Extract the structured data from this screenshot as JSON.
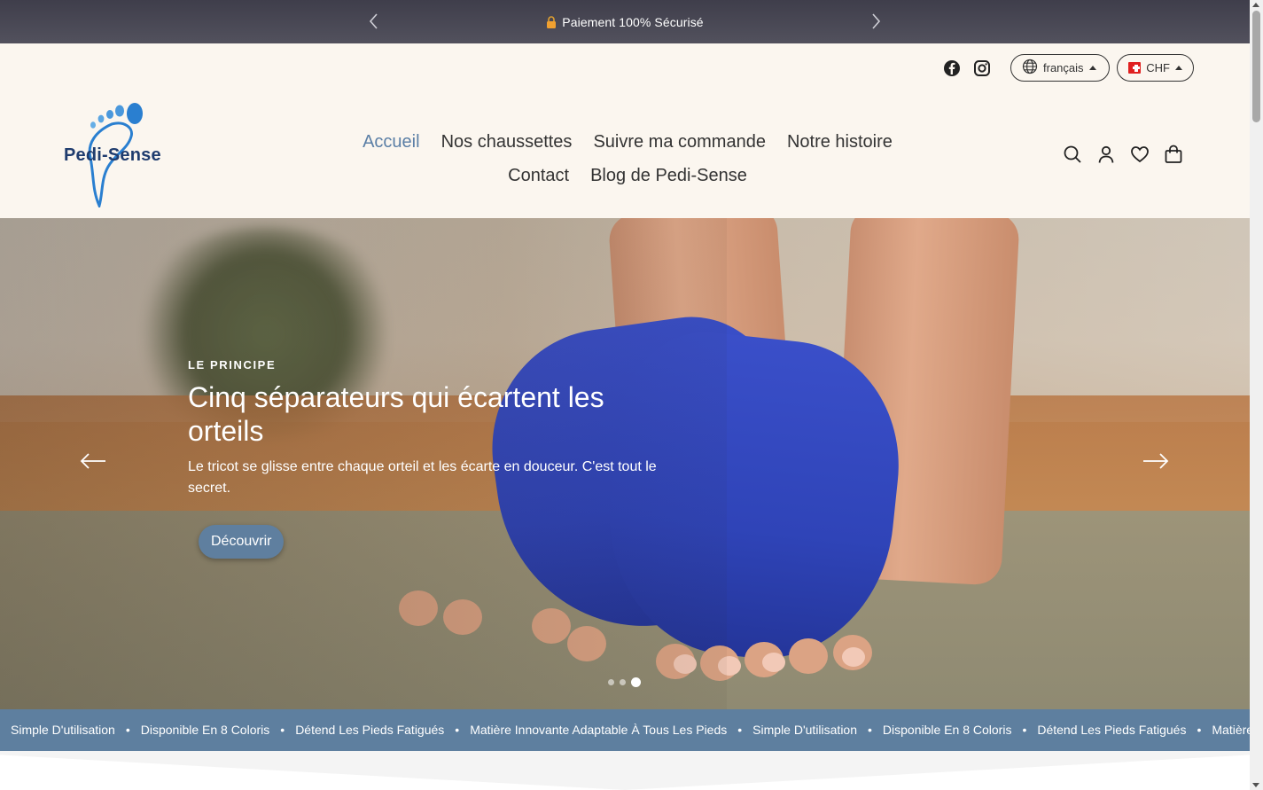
{
  "announcement": {
    "message": "Paiement 100% Sécurisé",
    "icons": {
      "prev": "chevron-left-icon",
      "next": "chevron-right-icon",
      "lock": "lock-icon"
    }
  },
  "header": {
    "logo_text": "Pedi-Sense",
    "social": [
      "facebook-icon",
      "instagram-icon"
    ],
    "language": {
      "label": "français",
      "icon": "globe-icon"
    },
    "currency": {
      "label": "CHF",
      "icon": "swiss-flag-icon"
    },
    "nav_row1": [
      {
        "label": "Accueil",
        "active": true
      },
      {
        "label": "Nos chaussettes"
      },
      {
        "label": "Suivre ma commande"
      },
      {
        "label": "Notre histoire"
      }
    ],
    "nav_row2": [
      {
        "label": "Contact"
      },
      {
        "label": "Blog de Pedi-Sense"
      }
    ],
    "utility_icons": [
      "search-icon",
      "account-icon",
      "wishlist-heart-icon",
      "cart-bag-icon"
    ]
  },
  "hero": {
    "eyebrow": "LE PRINCIPE",
    "title": "Cinq séparateurs qui écartent les orteils",
    "subtitle": "Le tricot se glisse entre chaque orteil et les écarte en douceur. C'est tout le secret.",
    "cta": "Découvrir",
    "slides_total": 3,
    "active_slide": 3
  },
  "marquee": {
    "items": [
      "Simple D'utilisation",
      "Disponible En 8 Coloris",
      "Détend Les Pieds Fatigués",
      "Matière Innovante Adaptable À Tous Les Pieds",
      "Simple D'utilisation",
      "Disponible En 8 Coloris",
      "Détend Les Pieds Fatigués",
      "Matière Innovante Adaptable À Tous Les Pieds"
    ],
    "separator": "•"
  },
  "colors": {
    "announcement_bg": "#46454f",
    "header_bg": "#fbf6ef",
    "accent": "#5e7f9f",
    "nav_active": "#5b7fa6",
    "logo_blue": "#1f3c6e"
  }
}
